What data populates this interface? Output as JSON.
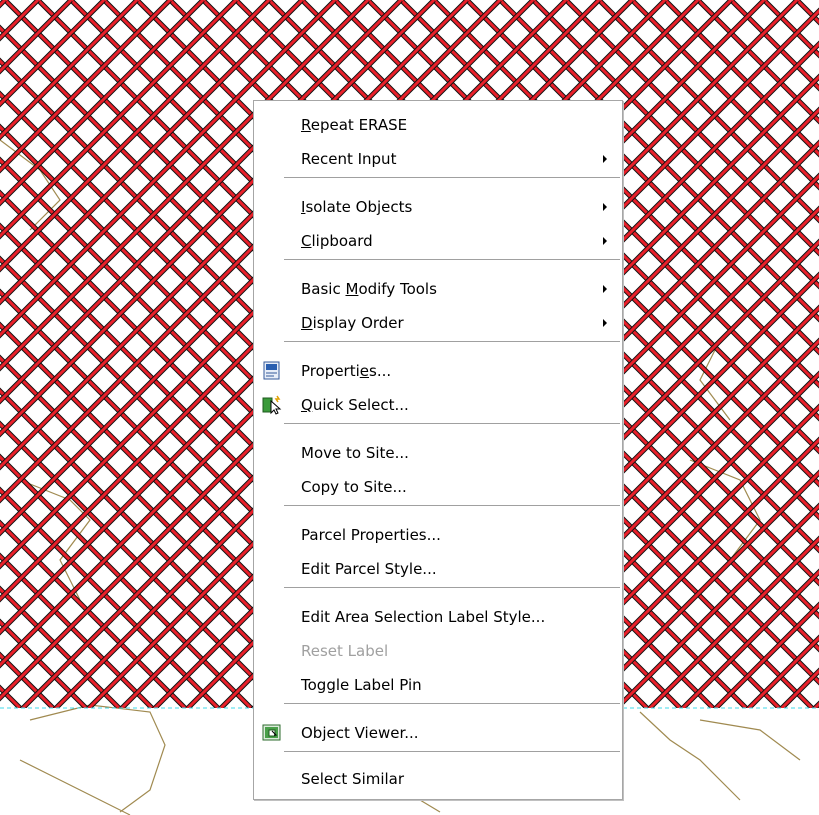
{
  "menu": {
    "items": [
      {
        "pre": "",
        "acc": "R",
        "post": "epeat ERASE",
        "submenu": false,
        "disabled": false,
        "icon": ""
      },
      {
        "pre": "Recent Input",
        "acc": "",
        "post": "",
        "submenu": true,
        "disabled": false,
        "icon": ""
      },
      {
        "pre": "",
        "acc": "I",
        "post": "solate Objects",
        "submenu": true,
        "disabled": false,
        "icon": ""
      },
      {
        "pre": "",
        "acc": "C",
        "post": "lipboard",
        "submenu": true,
        "disabled": false,
        "icon": ""
      },
      {
        "pre": "Basic ",
        "acc": "M",
        "post": "odify Tools",
        "submenu": true,
        "disabled": false,
        "icon": ""
      },
      {
        "pre": "",
        "acc": "D",
        "post": "isplay Order",
        "submenu": true,
        "disabled": false,
        "icon": ""
      },
      {
        "pre": "Properti",
        "acc": "e",
        "post": "s...",
        "submenu": false,
        "disabled": false,
        "icon": "properties-icon"
      },
      {
        "pre": "",
        "acc": "Q",
        "post": "uick Select...",
        "submenu": false,
        "disabled": false,
        "icon": "quick-select-icon"
      },
      {
        "pre": "Move to Site...",
        "acc": "",
        "post": "",
        "submenu": false,
        "disabled": false,
        "icon": ""
      },
      {
        "pre": "Copy to Site...",
        "acc": "",
        "post": "",
        "submenu": false,
        "disabled": false,
        "icon": ""
      },
      {
        "pre": "Parcel Properties...",
        "acc": "",
        "post": "",
        "submenu": false,
        "disabled": false,
        "icon": ""
      },
      {
        "pre": "Edit Parcel Style...",
        "acc": "",
        "post": "",
        "submenu": false,
        "disabled": false,
        "icon": ""
      },
      {
        "pre": "Edit Area Selection Label Style...",
        "acc": "",
        "post": "",
        "submenu": false,
        "disabled": false,
        "icon": ""
      },
      {
        "pre": "Reset Label",
        "acc": "",
        "post": "",
        "submenu": false,
        "disabled": true,
        "icon": ""
      },
      {
        "pre": "Toggle Label Pin",
        "acc": "",
        "post": "",
        "submenu": false,
        "disabled": false,
        "icon": ""
      },
      {
        "pre": "Object Viewer...",
        "acc": "",
        "post": "",
        "submenu": false,
        "disabled": false,
        "icon": "object-viewer-icon"
      },
      {
        "pre": "Select Similar",
        "acc": "",
        "post": "",
        "submenu": false,
        "disabled": false,
        "icon": ""
      }
    ]
  },
  "colors": {
    "hatch": "#e8202a",
    "hatch_edge": "#111111",
    "contour": "#a08a50",
    "boundary": "#40d8e8"
  }
}
